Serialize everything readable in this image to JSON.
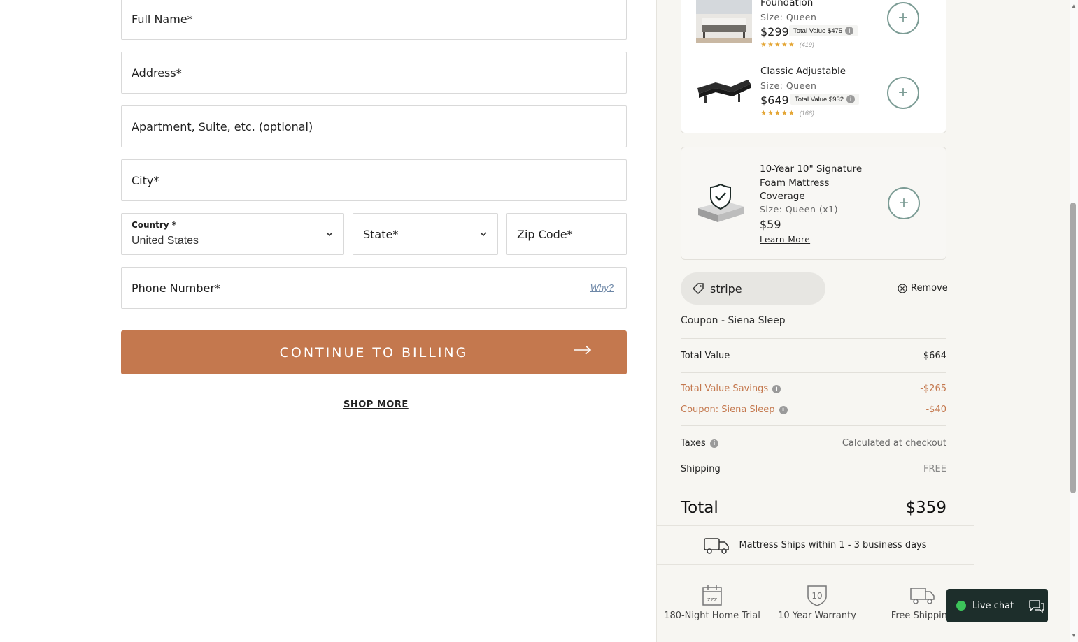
{
  "form": {
    "full_name_placeholder": "Full Name*",
    "address_placeholder": "Address*",
    "apartment_placeholder": "Apartment, Suite, etc. (optional)",
    "city_placeholder": "City*",
    "country_label": "Country *",
    "country_value": "United States",
    "state_placeholder": "State*",
    "zip_placeholder": "Zip Code*",
    "phone_placeholder": "Phone Number*",
    "phone_why": "Why?",
    "continue_label": "CONTINUE TO BILLING",
    "shop_more_label": "SHOP MORE"
  },
  "upsells": [
    {
      "name": "Foundation",
      "size": "Size: Queen",
      "price": "$299",
      "total_value": "Total Value $475",
      "reviews": "(419)"
    },
    {
      "name": "Classic Adjustable",
      "size": "Size: Queen",
      "price": "$649",
      "total_value": "Total Value $932",
      "reviews": "(166)"
    }
  ],
  "coverage": {
    "name": "10-Year 10\" Signature Foam Mattress Coverage",
    "size": "Size: Queen (x1)",
    "price": "$59",
    "learn_more": "Learn More"
  },
  "coupon": {
    "code": "stripe",
    "remove_label": "Remove",
    "note": "Coupon - Siena Sleep"
  },
  "summary": {
    "total_value_label": "Total Value",
    "total_value": "$664",
    "savings_label": "Total Value Savings",
    "savings": "-$265",
    "coupon_label": "Coupon: Siena Sleep",
    "coupon_amount": "-$40",
    "taxes_label": "Taxes",
    "taxes_value": "Calculated at checkout",
    "shipping_label": "Shipping",
    "shipping_value": "FREE",
    "total_label": "Total",
    "total": "$359"
  },
  "shipping_note": "Mattress Ships within 1 - 3 business days",
  "features": [
    {
      "label": "180-Night Home Trial",
      "icon": "calendar-zzz-icon"
    },
    {
      "label": "10 Year Warranty",
      "icon": "shield-10-icon"
    },
    {
      "label": "Free Shipping",
      "icon": "truck-icon"
    }
  ],
  "livechat_label": "Live chat",
  "colors": {
    "cta": "#c4784e",
    "accent_green": "#7c9c95",
    "chat_bg": "#1d2e2b"
  }
}
